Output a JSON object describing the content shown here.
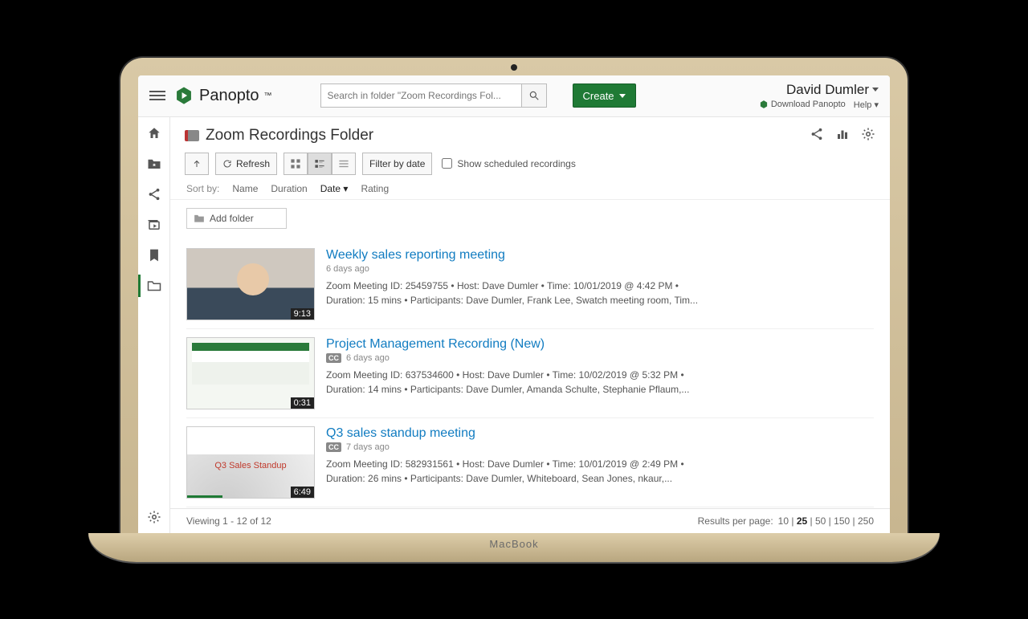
{
  "header": {
    "brand": "Panopto",
    "search_placeholder": "Search in folder \"Zoom Recordings Fol...",
    "create_label": "Create",
    "user_name": "David Dumler",
    "download_label": "Download Panopto",
    "help_label": "Help"
  },
  "folder": {
    "title": "Zoom Recordings Folder"
  },
  "toolbar": {
    "refresh": "Refresh",
    "filter": "Filter by date",
    "scheduled": "Show scheduled recordings"
  },
  "sort": {
    "label": "Sort by:",
    "options": [
      "Name",
      "Duration",
      "Date",
      "Rating"
    ],
    "active": "Date"
  },
  "addfolder": "Add folder",
  "items": [
    {
      "title": "Weekly sales reporting meeting",
      "age": "6 days ago",
      "cc": false,
      "duration": "9:13",
      "progress": 0,
      "line1": "Zoom Meeting ID: 25459755   •  Host: Dave Dumler   •  Time: 10/01/2019 @ 4:42 PM   •",
      "line2": "Duration: 15 mins   •  Participants: Dave Dumler, Frank Lee, Swatch meeting room, Tim..."
    },
    {
      "title": "Project Management Recording (New)",
      "age": "6 days ago",
      "cc": true,
      "duration": "0:31",
      "progress": 0,
      "line1": "Zoom Meeting ID: 637534600   •  Host: Dave Dumler   •  Time: 10/02/2019 @ 5:32 PM   •",
      "line2": "Duration: 14 mins   •  Participants: Dave Dumler, Amanda Schulte, Stephanie Pflaum,..."
    },
    {
      "title": "Q3 sales standup meeting",
      "age": "7 days ago",
      "cc": true,
      "duration": "6:49",
      "progress": 28,
      "thumb_label": "Q3 Sales Standup",
      "line1": "Zoom Meeting ID: 582931561   •  Host: Dave Dumler   •  Time: 10/01/2019 @ 2:49 PM   •",
      "line2": "Duration: 26 mins   •  Participants: Dave Dumler, Whiteboard, Sean Jones, nkaur,..."
    }
  ],
  "footer": {
    "viewing": "Viewing 1 - 12 of 12",
    "rpp_label": "Results per page:",
    "rpp_options": [
      "10",
      "25",
      "50",
      "150",
      "250"
    ],
    "rpp_selected": "25"
  }
}
